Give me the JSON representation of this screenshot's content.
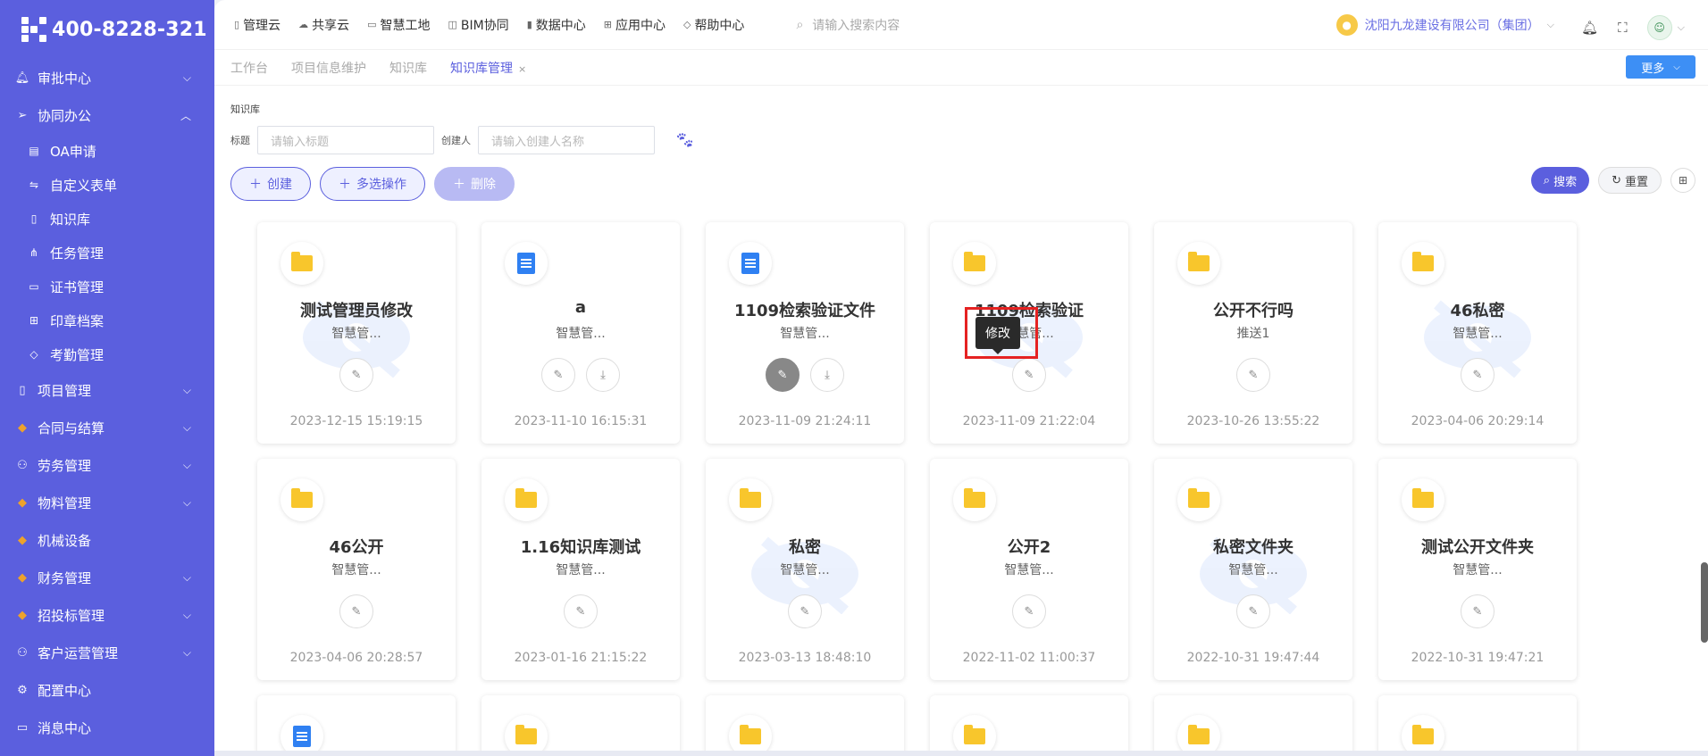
{
  "brand": {
    "phone": "400-8228-321"
  },
  "sidebar": {
    "items": [
      {
        "label": "审批中心",
        "icon": "bell-icon",
        "chev": "⌄"
      },
      {
        "label": "协同办公",
        "icon": "send-icon",
        "chev": "⌃"
      },
      {
        "label": "项目管理",
        "icon": "book-icon",
        "chev": "⌄"
      },
      {
        "label": "合同与结算",
        "icon": "gem-icon",
        "chev": "⌄"
      },
      {
        "label": "劳务管理",
        "icon": "user-icon",
        "chev": "⌄"
      },
      {
        "label": "物料管理",
        "icon": "gem-icon",
        "chev": "⌄"
      },
      {
        "label": "机械设备",
        "icon": "gem-icon",
        "chev": ""
      },
      {
        "label": "财务管理",
        "icon": "gem-icon",
        "chev": "⌄"
      },
      {
        "label": "招投标管理",
        "icon": "gem-icon",
        "chev": "⌄"
      },
      {
        "label": "客户运营管理",
        "icon": "user-icon",
        "chev": "⌄"
      },
      {
        "label": "配置中心",
        "icon": "gear-icon",
        "chev": ""
      },
      {
        "label": "消息中心",
        "icon": "message-icon",
        "chev": ""
      }
    ],
    "sub_items": [
      {
        "label": "OA申请",
        "icon": "file-icon"
      },
      {
        "label": "自定义表单",
        "icon": "sliders-icon"
      },
      {
        "label": "知识库",
        "icon": "book-icon"
      },
      {
        "label": "任务管理",
        "icon": "sitemap-icon"
      },
      {
        "label": "证书管理",
        "icon": "certificate-icon"
      },
      {
        "label": "印章档案",
        "icon": "grid-icon"
      },
      {
        "label": "考勤管理",
        "icon": "tag-icon"
      }
    ]
  },
  "topnav": {
    "items": [
      {
        "label": "管理云",
        "icon": "page-icon"
      },
      {
        "label": "共享云",
        "icon": "cloud-icon"
      },
      {
        "label": "智慧工地",
        "icon": "monitor-icon"
      },
      {
        "label": "BIM协同",
        "icon": "cube-icon"
      },
      {
        "label": "数据中心",
        "icon": "bar-chart-icon"
      },
      {
        "label": "应用中心",
        "icon": "apps-icon"
      },
      {
        "label": "帮助中心",
        "icon": "diamond-icon"
      }
    ],
    "search_placeholder": "请输入搜索内容",
    "company": "沈阳九龙建设有限公司（集团）"
  },
  "tabs": {
    "items": [
      "工作台",
      "项目信息维护",
      "知识库",
      "知识库管理"
    ],
    "active_index": 3,
    "close": "×",
    "more": "更多"
  },
  "breadcrumb": "知识库",
  "filters": {
    "title_label": "标题",
    "title_placeholder": "请输入标题",
    "creator_label": "创建人",
    "creator_placeholder": "请输入创建人名称"
  },
  "actions": {
    "create": "创建",
    "multi": "多选操作",
    "delete": "删除",
    "search": "搜索",
    "reset": "重置"
  },
  "tooltip": "修改",
  "cards": [
    {
      "title": "测试管理员修改",
      "sub": "智慧管...",
      "date": "2023-12-15 15:19:15",
      "type": "folder",
      "download": false,
      "watermark": true
    },
    {
      "title": "a",
      "sub": "智慧管...",
      "date": "2023-11-10 16:15:31",
      "type": "doc",
      "download": true,
      "watermark": false
    },
    {
      "title": "1109检索验证文件",
      "sub": "智慧管...",
      "date": "2023-11-09 21:24:11",
      "type": "doc",
      "download": true,
      "watermark": false,
      "hover": true
    },
    {
      "title": "1109检索验证",
      "sub": "智慧管...",
      "date": "2023-11-09 21:22:04",
      "type": "folder",
      "download": false,
      "watermark": true
    },
    {
      "title": "公开不行吗",
      "sub": "推送1",
      "date": "2023-10-26 13:55:22",
      "type": "folder",
      "download": false,
      "watermark": false
    },
    {
      "title": "46私密",
      "sub": "智慧管...",
      "date": "2023-04-06 20:29:14",
      "type": "folder",
      "download": false,
      "watermark": true
    },
    {
      "title": "46公开",
      "sub": "智慧管...",
      "date": "2023-04-06 20:28:57",
      "type": "folder",
      "download": false,
      "watermark": false
    },
    {
      "title": "1.16知识库测试",
      "sub": "智慧管...",
      "date": "2023-01-16 21:15:22",
      "type": "folder",
      "download": false,
      "watermark": false
    },
    {
      "title": "私密",
      "sub": "智慧管...",
      "date": "2023-03-13 18:48:10",
      "type": "folder",
      "download": false,
      "watermark": true
    },
    {
      "title": "公开2",
      "sub": "智慧管...",
      "date": "2022-11-02 11:00:37",
      "type": "folder",
      "download": false,
      "watermark": false
    },
    {
      "title": "私密文件夹",
      "sub": "智慧管...",
      "date": "2022-10-31 19:47:44",
      "type": "folder",
      "download": false,
      "watermark": true
    },
    {
      "title": "测试公开文件夹",
      "sub": "智慧管...",
      "date": "2022-10-31 19:47:21",
      "type": "folder",
      "download": false,
      "watermark": false
    }
  ],
  "partial_cards": [
    "doc",
    "folder",
    "folder",
    "folder",
    "folder",
    "folder"
  ]
}
